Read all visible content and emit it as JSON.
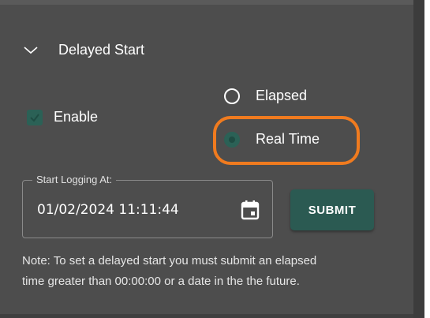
{
  "section": {
    "title": "Delayed Start",
    "expanded": true
  },
  "enable": {
    "label": "Enable",
    "checked": true
  },
  "mode": {
    "options": [
      {
        "label": "Elapsed",
        "selected": false
      },
      {
        "label": "Real Time",
        "selected": true
      }
    ],
    "highlight_color": "#f07b1f"
  },
  "start_logging": {
    "label": "Start Logging At:",
    "value": "01/02/2024 11:11:44"
  },
  "submit": {
    "label": "SUBMIT"
  },
  "note": {
    "line1": "Note: To set a delayed start you must submit an elapsed",
    "line2": "time greater than 00:00:00 or a date in the the future."
  },
  "colors": {
    "panel_bg": "#4d4d4d",
    "accent": "#2b5a52",
    "text": "#ffffff"
  }
}
